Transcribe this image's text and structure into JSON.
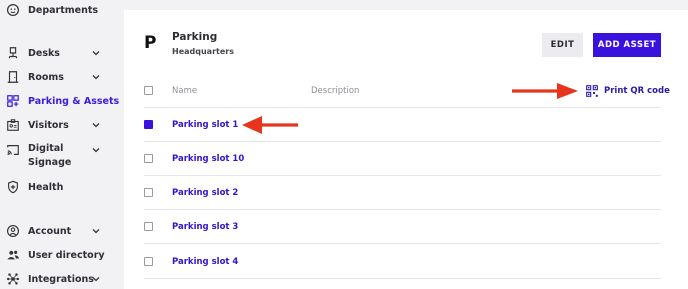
{
  "sidebar": {
    "items": [
      {
        "label": "Departments",
        "icon": "smiley-icon",
        "chevron": false
      },
      {
        "label": "Desks",
        "icon": "desk-chair-icon",
        "chevron": true
      },
      {
        "label": "Rooms",
        "icon": "door-icon",
        "chevron": true
      },
      {
        "label": "Parking & Assets",
        "icon": "assets-grid-icon",
        "chevron": false,
        "active": true
      },
      {
        "label": "Visitors",
        "icon": "visitor-badge-icon",
        "chevron": true
      },
      {
        "label": "Digital Signage",
        "icon": "cast-icon",
        "chevron": true
      },
      {
        "label": "Health",
        "icon": "shield-icon",
        "chevron": false
      },
      {
        "label": "Account",
        "icon": "account-circle-icon",
        "chevron": true
      },
      {
        "label": "User directory",
        "icon": "users-icon",
        "chevron": false
      },
      {
        "label": "Integrations",
        "icon": "integrations-icon",
        "chevron": true
      }
    ],
    "accent": "#3d1be0"
  },
  "header": {
    "letter": "P",
    "title": "Parking",
    "subtitle": "Headquarters",
    "edit_label": "EDIT",
    "add_label": "ADD ASSET"
  },
  "table": {
    "columns": {
      "name": "Name",
      "description": "Description"
    },
    "print_qr_label": "Print QR code",
    "rows": [
      {
        "name": "Parking slot 1",
        "checked": true
      },
      {
        "name": "Parking slot 10",
        "checked": false
      },
      {
        "name": "Parking slot 2",
        "checked": false
      },
      {
        "name": "Parking slot 3",
        "checked": false
      },
      {
        "name": "Parking slot 4",
        "checked": false
      }
    ]
  },
  "colors": {
    "primary": "#3a12dd",
    "arrow": "#e8341c"
  }
}
